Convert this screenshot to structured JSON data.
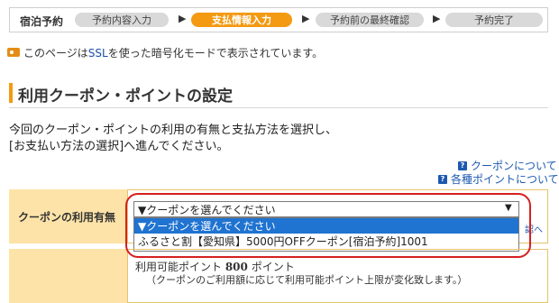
{
  "progress": {
    "label": "宿泊予約",
    "steps": [
      {
        "label": "予約内容入力",
        "active": false
      },
      {
        "label": "支払情報入力",
        "active": true
      },
      {
        "label": "予約前の最終確認",
        "active": false
      },
      {
        "label": "予約完了",
        "active": false
      }
    ],
    "arrow": "▶"
  },
  "ssl": {
    "prefix": "このページは",
    "highlight": "SSL",
    "suffix": "を使った暗号化モードで表示されています。"
  },
  "section": {
    "title": "利用クーポン・ポイントの設定"
  },
  "intro": {
    "line1": "今回のクーポン・ポイントの利用の有無と支払方法を選択し、",
    "line2": "[お支払い方法の選択]へ進んでください。"
  },
  "help": {
    "coupon_link": "クーポンについて",
    "points_link": "各種ポイントについて",
    "icon": "?"
  },
  "coupon": {
    "label": "クーポンの利用有無",
    "selected": "▼クーポンを選んでください",
    "arrow": "▼",
    "options": [
      "▼クーポンを選んでください",
      "ふるさと割【愛知県】5000円OFFクーポン[宿泊予約]1001"
    ],
    "cut_text": "認へ"
  },
  "points": {
    "line1_prefix": "利用可能ポイント ",
    "line1_value": "800",
    "line1_suffix": " ポイント",
    "line2": "（クーポンのご利用額に応じて利用可能ポイント上限が変化致します。）"
  },
  "colors": {
    "accent": "#f39a12",
    "selected": "#1f73d1",
    "highlight": "#d61f1f",
    "link": "#1d58b0"
  }
}
